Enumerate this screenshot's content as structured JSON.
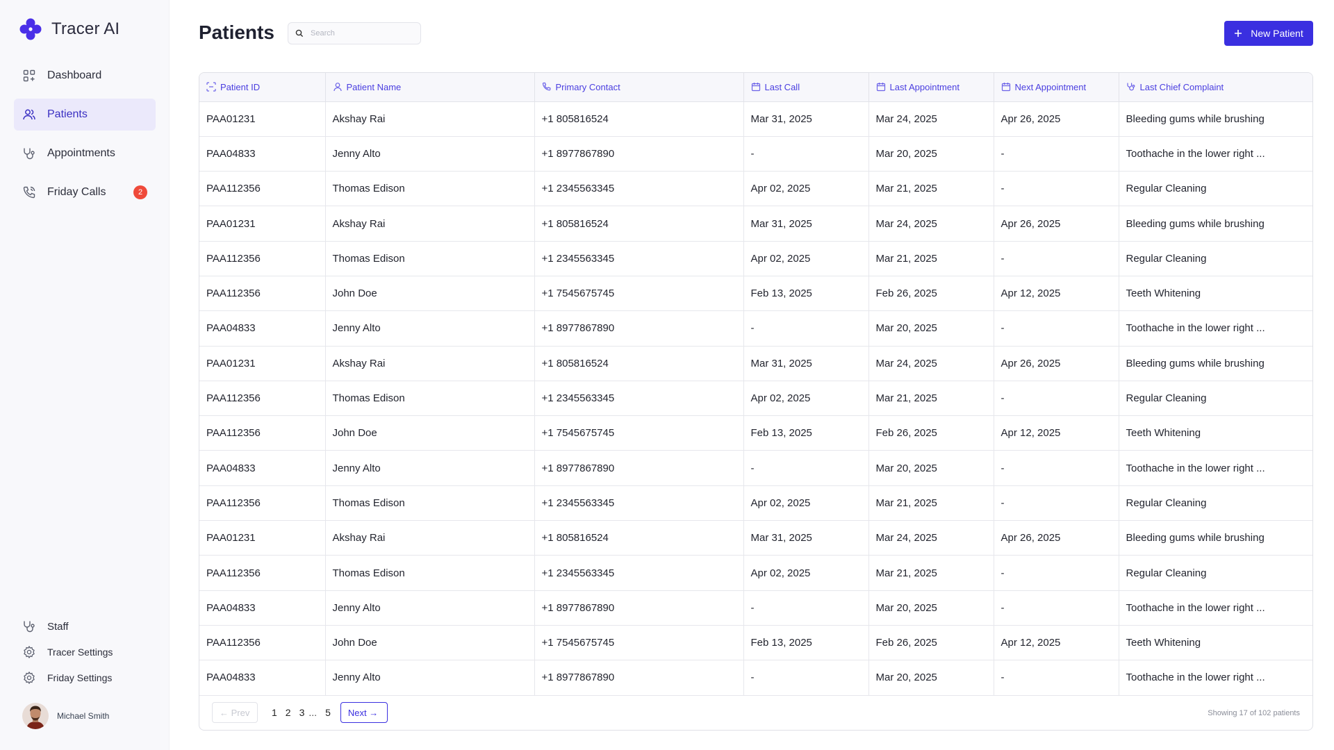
{
  "brand": {
    "name": "Tracer AI",
    "accent": "#3a2fe0"
  },
  "sidebar": {
    "items": [
      {
        "label": "Dashboard",
        "icon": "grid-icon"
      },
      {
        "label": "Patients",
        "icon": "users-icon",
        "active": true
      },
      {
        "label": "Appointments",
        "icon": "stethoscope-icon"
      },
      {
        "label": "Friday Calls",
        "icon": "phone-icon",
        "badge": "2"
      }
    ],
    "bottom_items": [
      {
        "label": "Staff",
        "icon": "stethoscope-icon"
      },
      {
        "label": "Tracer Settings",
        "icon": "gear-icon"
      },
      {
        "label": "Friday Settings",
        "icon": "gear-icon"
      }
    ],
    "user": {
      "name": "Michael Smith"
    }
  },
  "header": {
    "title": "Patients",
    "search_placeholder": "Search",
    "new_button": "New Patient"
  },
  "table": {
    "columns": [
      "Patient ID",
      "Patient Name",
      "Primary Contact",
      "Last Call",
      "Last Appointment",
      "Next Appointment",
      "Last Chief Complaint"
    ],
    "rows": [
      [
        "PAA01231",
        "Akshay Rai",
        "+1 805816524",
        "Mar 31, 2025",
        "Mar 24, 2025",
        "Apr 26, 2025",
        "Bleeding gums while brushing"
      ],
      [
        "PAA04833",
        "Jenny Alto",
        "+1 8977867890",
        "-",
        "Mar 20, 2025",
        "-",
        "Toothache in the lower right ..."
      ],
      [
        "PAA112356",
        "Thomas Edison",
        "+1 2345563345",
        "Apr 02, 2025",
        "Mar 21, 2025",
        "-",
        "Regular Cleaning"
      ],
      [
        "PAA01231",
        "Akshay Rai",
        "+1 805816524",
        "Mar 31, 2025",
        "Mar 24, 2025",
        "Apr 26, 2025",
        "Bleeding gums while brushing"
      ],
      [
        "PAA112356",
        "Thomas Edison",
        "+1 2345563345",
        "Apr 02, 2025",
        "Mar 21, 2025",
        "-",
        "Regular Cleaning"
      ],
      [
        "PAA112356",
        "John Doe",
        "+1 7545675745",
        "Feb 13, 2025",
        "Feb 26, 2025",
        "Apr 12, 2025",
        "Teeth Whitening"
      ],
      [
        "PAA04833",
        "Jenny Alto",
        "+1 8977867890",
        "-",
        "Mar 20, 2025",
        "-",
        "Toothache in the lower right ..."
      ],
      [
        "PAA01231",
        "Akshay Rai",
        "+1 805816524",
        "Mar 31, 2025",
        "Mar 24, 2025",
        "Apr 26, 2025",
        "Bleeding gums while brushing"
      ],
      [
        "PAA112356",
        "Thomas Edison",
        "+1 2345563345",
        "Apr 02, 2025",
        "Mar 21, 2025",
        "-",
        "Regular Cleaning"
      ],
      [
        "PAA112356",
        "John Doe",
        "+1 7545675745",
        "Feb 13, 2025",
        "Feb 26, 2025",
        "Apr 12, 2025",
        "Teeth Whitening"
      ],
      [
        "PAA04833",
        "Jenny Alto",
        "+1 8977867890",
        "-",
        "Mar 20, 2025",
        "-",
        "Toothache in the lower right ..."
      ],
      [
        "PAA112356",
        "Thomas Edison",
        "+1 2345563345",
        "Apr 02, 2025",
        "Mar 21, 2025",
        "-",
        "Regular Cleaning"
      ],
      [
        "PAA01231",
        "Akshay Rai",
        "+1 805816524",
        "Mar 31, 2025",
        "Mar 24, 2025",
        "Apr 26, 2025",
        "Bleeding gums while brushing"
      ],
      [
        "PAA112356",
        "Thomas Edison",
        "+1 2345563345",
        "Apr 02, 2025",
        "Mar 21, 2025",
        "-",
        "Regular Cleaning"
      ],
      [
        "PAA04833",
        "Jenny Alto",
        "+1 8977867890",
        "-",
        "Mar 20, 2025",
        "-",
        "Toothache in the lower right ..."
      ],
      [
        "PAA112356",
        "John Doe",
        "+1 7545675745",
        "Feb 13, 2025",
        "Feb 26, 2025",
        "Apr 12, 2025",
        "Teeth Whitening"
      ],
      [
        "PAA04833",
        "Jenny Alto",
        "+1 8977867890",
        "-",
        "Mar 20, 2025",
        "-",
        "Toothache in the lower right ..."
      ]
    ]
  },
  "pagination": {
    "prev": "← Prev",
    "pages": [
      "1",
      "2",
      "3"
    ],
    "ellipsis": "...",
    "last_page": "5",
    "next": "Next →",
    "showing": "Showing 17 of 102 patients"
  }
}
